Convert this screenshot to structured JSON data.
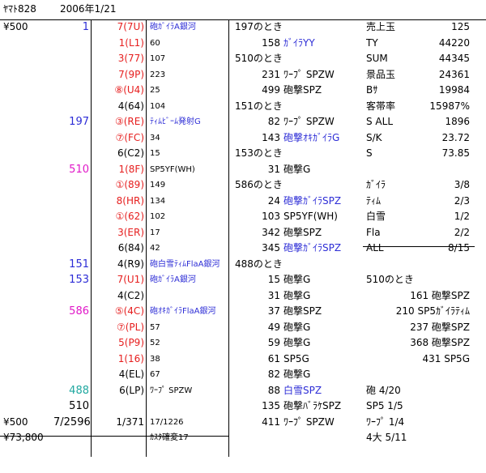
{
  "header": {
    "title": "ﾔﾏﾄ828",
    "date": "2006年1/21"
  },
  "rows": [
    {
      "a": "¥500",
      "b": "1",
      "b_color": "blue",
      "c": "7(7U)",
      "c_color": "red",
      "d": "砲ｶﾞｲﾗA銀河",
      "d_color": "blue",
      "e_left": "197のとき",
      "e_num": "",
      "f": "",
      "f_color": "",
      "g": "売上玉",
      "h": "125"
    },
    {
      "a": "",
      "b": "",
      "b_color": "",
      "c": "1(L1)",
      "c_color": "red",
      "d": "60",
      "d_color": "",
      "e_left": "",
      "e_num": "158",
      "f": "ｶﾞｲﾗYY",
      "f_color": "blue",
      "g": "TY",
      "h": "44220"
    },
    {
      "a": "",
      "b": "",
      "b_color": "",
      "c": "3(77)",
      "c_color": "red",
      "d": "107",
      "d_color": "",
      "e_left": "510のとき",
      "e_num": "",
      "f": "",
      "f_color": "",
      "g": "SUM",
      "h": "44345"
    },
    {
      "a": "",
      "b": "",
      "b_color": "",
      "c": "7(9P)",
      "c_color": "red",
      "d": "223",
      "d_color": "",
      "e_left": "",
      "e_num": "231",
      "f": "ﾜｰﾌﾟ SPZW",
      "f_color": "",
      "g": "景品玉",
      "h": "24361"
    },
    {
      "a": "",
      "b": "",
      "b_color": "",
      "c": "⑧(U4)",
      "c_color": "red",
      "d": "25",
      "d_color": "",
      "e_left": "",
      "e_num": "499",
      "f": "砲撃SPZ",
      "f_color": "",
      "g": "Bｻ",
      "h": "19984"
    },
    {
      "a": "",
      "b": "",
      "b_color": "",
      "c": "4(64)",
      "c_color": "",
      "d": "104",
      "d_color": "",
      "e_left": "151のとき",
      "e_num": "",
      "f": "",
      "f_color": "",
      "g": "客帯率",
      "h": "15987%"
    },
    {
      "a": "",
      "b": "197",
      "b_color": "blue",
      "c": "③(RE)",
      "c_color": "red",
      "d": "ﾃｨﾑﾋﾞｰﾑ発射G",
      "d_color": "blue",
      "e_left": "",
      "e_num": "82",
      "f": "ﾜｰﾌﾟ SPZW",
      "f_color": "",
      "g": "S ALL",
      "h": "1896"
    },
    {
      "a": "",
      "b": "",
      "b_color": "",
      "c": "⑦(FC)",
      "c_color": "red",
      "d": "34",
      "d_color": "",
      "e_left": "",
      "e_num": "143",
      "f": "砲撃ｵｷｶﾞｲﾗG",
      "f_color": "blue",
      "g": "S/K",
      "h": "23.72"
    },
    {
      "a": "",
      "b": "",
      "b_color": "",
      "c": "6(C2)",
      "c_color": "",
      "d": "15",
      "d_color": "",
      "e_left": "153のとき",
      "e_num": "",
      "f": "",
      "f_color": "",
      "g": "S",
      "h": "73.85"
    },
    {
      "a": "",
      "b": "510",
      "b_color": "mag",
      "c": "1(8F)",
      "c_color": "red",
      "d": "SP5YF(WH)",
      "d_color": "",
      "e_left": "",
      "e_num": "31",
      "f": "砲撃G",
      "f_color": "",
      "g": "",
      "h": ""
    },
    {
      "a": "",
      "b": "",
      "b_color": "",
      "c": "①(89)",
      "c_color": "red",
      "d": "149",
      "d_color": "",
      "e_left": "586のとき",
      "e_num": "",
      "f": "",
      "f_color": "",
      "g": "ｶﾞｲﾗ",
      "h": "3/8"
    },
    {
      "a": "",
      "b": "",
      "b_color": "",
      "c": "8(HR)",
      "c_color": "red",
      "d": "134",
      "d_color": "",
      "e_left": "",
      "e_num": "24",
      "f": "砲撃ｶﾞｲﾗSPZ",
      "f_color": "blue",
      "g": "ﾃｨﾑ",
      "h": "2/3"
    },
    {
      "a": "",
      "b": "",
      "b_color": "",
      "c": "①(62)",
      "c_color": "red",
      "d": "102",
      "d_color": "",
      "e_left": "",
      "e_num": "103",
      "f": "SP5YF(WH)",
      "f_color": "",
      "g": "白雪",
      "h": "1/2"
    },
    {
      "a": "",
      "b": "",
      "b_color": "",
      "c": "3(ER)",
      "c_color": "red",
      "d": "17",
      "d_color": "",
      "e_left": "",
      "e_num": "342",
      "f": "砲撃SPZ",
      "f_color": "",
      "g": "Fla",
      "h": "2/2"
    },
    {
      "a": "",
      "b": "",
      "b_color": "",
      "c": "6(84)",
      "c_color": "",
      "d": "42",
      "d_color": "",
      "e_left": "",
      "e_num": "345",
      "f": "砲撃ｶﾞｲﾗSPZ",
      "f_color": "blue",
      "g": "ALL",
      "h": "8/15"
    },
    {
      "a": "",
      "b": "151",
      "b_color": "blue",
      "c": "4(R9)",
      "c_color": "",
      "d": "砲白雪ﾃｨﾑFlaA銀河",
      "d_color": "blue",
      "e_left": "488のとき",
      "e_num": "",
      "f": "",
      "f_color": "",
      "g": "",
      "h": ""
    },
    {
      "a": "",
      "b": "153",
      "b_color": "blue",
      "c": "7(U1)",
      "c_color": "red",
      "d": "砲ｶﾞｲﾗA銀河",
      "d_color": "blue",
      "e_left": "",
      "e_num": "15",
      "f": "砲撃G",
      "f_color": "",
      "g": "510のとき",
      "h": ""
    },
    {
      "a": "",
      "b": "",
      "b_color": "",
      "c": "4(C2)",
      "c_color": "",
      "d": "",
      "d_color": "",
      "e_left": "",
      "e_num": "31",
      "f": "砲撃G",
      "f_color": "",
      "g": "",
      "h": "161 砲撃SPZ"
    },
    {
      "a": "",
      "b": "586",
      "b_color": "mag",
      "c": "⑤(4C)",
      "c_color": "red",
      "d": "砲ｵｷｶﾞｲﾗFlaA銀河",
      "d_color": "blue",
      "e_left": "",
      "e_num": "37",
      "f": "砲撃SPZ",
      "f_color": "",
      "g": "",
      "h": "210 SP5ｶﾞｲﾗﾃｨﾑ"
    },
    {
      "a": "",
      "b": "",
      "b_color": "",
      "c": "⑦(PL)",
      "c_color": "red",
      "d": "57",
      "d_color": "",
      "e_left": "",
      "e_num": "49",
      "f": "砲撃G",
      "f_color": "",
      "g": "",
      "h": "237 砲撃SPZ"
    },
    {
      "a": "",
      "b": "",
      "b_color": "",
      "c": "5(P9)",
      "c_color": "red",
      "d": "52",
      "d_color": "",
      "e_left": "",
      "e_num": "59",
      "f": "砲撃G",
      "f_color": "",
      "g": "",
      "h": "368 砲撃SPZ"
    },
    {
      "a": "",
      "b": "",
      "b_color": "",
      "c": "1(16)",
      "c_color": "red",
      "d": "38",
      "d_color": "",
      "e_left": "",
      "e_num": "61",
      "f": "SP5G",
      "f_color": "",
      "g": "",
      "h": "431 SP5G"
    },
    {
      "a": "",
      "b": "",
      "b_color": "",
      "c": "4(EL)",
      "c_color": "",
      "d": "67",
      "d_color": "",
      "e_left": "",
      "e_num": "82",
      "f": "砲撃G",
      "f_color": "",
      "g": "",
      "h": ""
    },
    {
      "a": "",
      "b": "488",
      "b_color": "teal",
      "c": "6(LP)",
      "c_color": "",
      "d": "ﾜｰﾌﾟ SPZW",
      "d_color": "",
      "e_left": "",
      "e_num": "88",
      "f": "白雪SPZ",
      "f_color": "blue",
      "g": "砲 4/20",
      "h": ""
    },
    {
      "a": "",
      "b": "510",
      "b_color": "",
      "c": "",
      "c_color": "",
      "d": "",
      "d_color": "",
      "e_left": "",
      "e_num": "135",
      "f": "砲撃ﾊﾞﾗｹSPZ",
      "f_color": "",
      "g": "SP5 1/5",
      "h": ""
    },
    {
      "a": "¥500",
      "b": "7/2596",
      "b_color": "",
      "c": "1/371",
      "c_color": "",
      "d": "17/1226",
      "d_color": "",
      "e_left": "",
      "e_num": "411",
      "f": "ﾜｰﾌﾟ SPZW",
      "f_color": "",
      "g": "ﾜｰﾌﾟ 1/4",
      "h": ""
    },
    {
      "a": "¥73,800",
      "b": "",
      "b_color": "",
      "c": "",
      "c_color": "",
      "d": "ｶｽﾀ確変17",
      "d_color": "",
      "e_left": "",
      "e_num": "",
      "f": "",
      "f_color": "",
      "g": "4大 5/11",
      "h": ""
    }
  ]
}
